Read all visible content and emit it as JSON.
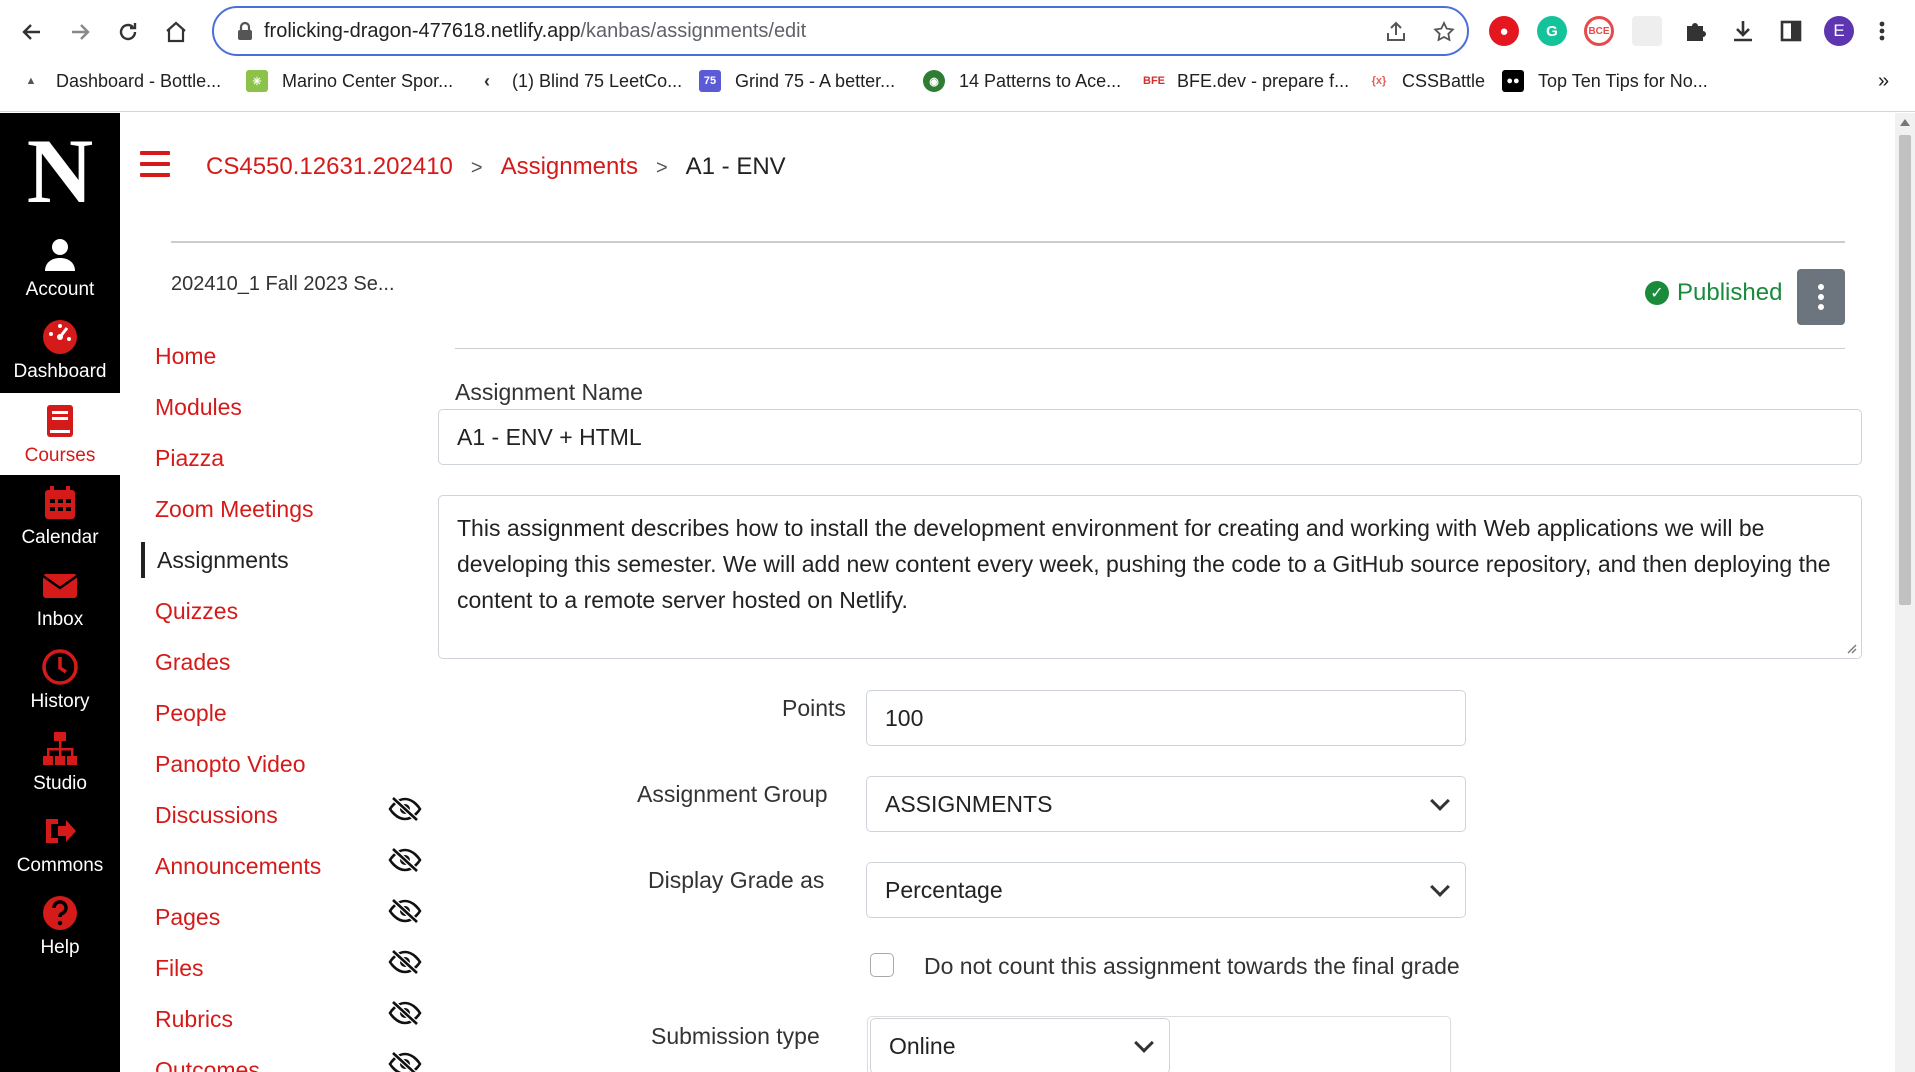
{
  "browser": {
    "url_host": "frolicking-dragon-477618.netlify.app",
    "url_path": "/kanbas/assignments/edit",
    "profile_initial": "E",
    "bookmarks": [
      {
        "label": "Dashboard - Bottle...",
        "icon": "bottle-icon"
      },
      {
        "label": "Marino Center Spor...",
        "icon": "marino-icon"
      },
      {
        "label": "(1) Blind 75 LeetCo...",
        "icon": "leetcode-icon"
      },
      {
        "label": "Grind 75 - A better...",
        "icon": "grind75-icon",
        "badge": "75"
      },
      {
        "label": "14 Patterns to Ace...",
        "icon": "patterns-icon"
      },
      {
        "label": "BFE.dev - prepare f...",
        "icon": "bfe-icon",
        "badge": "BFE"
      },
      {
        "label": "CSSBattle",
        "icon": "cssbattle-icon",
        "badge": "{x}"
      },
      {
        "label": "Top Ten Tips for No...",
        "icon": "medium-icon"
      }
    ],
    "more_bookmarks": "»"
  },
  "global_nav": {
    "logo": "N",
    "items": [
      {
        "label": "Account",
        "icon": "user-icon"
      },
      {
        "label": "Dashboard",
        "icon": "dashboard-icon"
      },
      {
        "label": "Courses",
        "icon": "book-icon",
        "active": true
      },
      {
        "label": "Calendar",
        "icon": "calendar-icon"
      },
      {
        "label": "Inbox",
        "icon": "envelope-icon"
      },
      {
        "label": "History",
        "icon": "clock-icon"
      },
      {
        "label": "Studio",
        "icon": "network-icon"
      },
      {
        "label": "Commons",
        "icon": "share-icon"
      },
      {
        "label": "Help",
        "icon": "question-icon"
      }
    ]
  },
  "breadcrumb": {
    "course": "CS4550.12631.202410",
    "section": "Assignments",
    "current": "A1 - ENV",
    "separator": ">"
  },
  "term_label": "202410_1 Fall 2023 Se...",
  "status": {
    "label": "Published",
    "color": "#1a8a3b"
  },
  "course_nav": {
    "items": [
      {
        "label": "Home"
      },
      {
        "label": "Modules"
      },
      {
        "label": "Piazza"
      },
      {
        "label": "Zoom Meetings"
      },
      {
        "label": "Assignments",
        "active": true
      },
      {
        "label": "Quizzes"
      },
      {
        "label": "Grades"
      },
      {
        "label": "People"
      },
      {
        "label": "Panopto Video"
      },
      {
        "label": "Discussions",
        "hidden": true
      },
      {
        "label": "Announcements",
        "hidden": true
      },
      {
        "label": "Pages",
        "hidden": true
      },
      {
        "label": "Files",
        "hidden": true
      },
      {
        "label": "Rubrics",
        "hidden": true
      },
      {
        "label": "Outcomes",
        "hidden": true
      }
    ]
  },
  "form": {
    "name_label": "Assignment Name",
    "name_value": "A1 - ENV + HTML",
    "description": "This assignment describes how to install the development environment for creating and working with Web applications we will be developing this semester. We will add new content every week, pushing the code to a GitHub source repository, and then deploying the content to a remote server hosted on Netlify.",
    "points_label": "Points",
    "points_value": "100",
    "group_label": "Assignment Group",
    "group_value": "ASSIGNMENTS",
    "display_label": "Display Grade as",
    "display_value": "Percentage",
    "exclude_label": "Do not count this assignment towards the final grade",
    "submission_label": "Submission type",
    "submission_value": "Online"
  },
  "colors": {
    "accent": "#d51a1a",
    "nav_bg": "#000000",
    "published": "#1a8a3b"
  }
}
